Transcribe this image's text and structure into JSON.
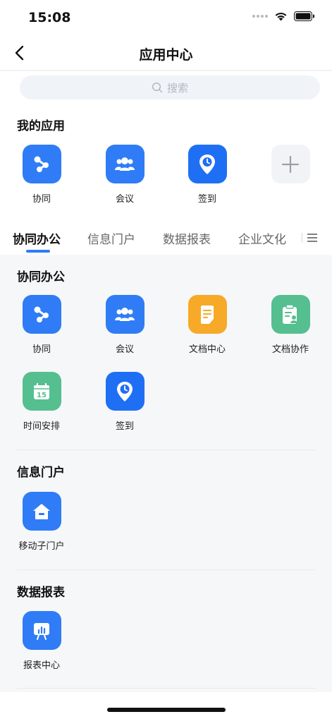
{
  "status": {
    "time": "15:08"
  },
  "nav": {
    "title": "应用中心"
  },
  "search": {
    "placeholder": "搜索"
  },
  "my_apps": {
    "title": "我的应用",
    "items": [
      {
        "label": "协同",
        "icon": "share-nodes-icon",
        "color": "#2f7cf6"
      },
      {
        "label": "会议",
        "icon": "people-group-icon",
        "color": "#2f7cf6"
      },
      {
        "label": "签到",
        "icon": "location-clock-icon",
        "color": "#1f6ff5"
      },
      {
        "label": "",
        "icon": "plus-icon",
        "color": "#f1f3f7"
      }
    ]
  },
  "tabs": [
    {
      "label": "协同办公",
      "active": true
    },
    {
      "label": "信息门户",
      "active": false
    },
    {
      "label": "数据报表",
      "active": false
    },
    {
      "label": "企业文化",
      "active": false
    }
  ],
  "categories": [
    {
      "title": "协同办公",
      "items": [
        {
          "label": "协同",
          "icon": "share-nodes-icon",
          "color": "#2f7cf6"
        },
        {
          "label": "会议",
          "icon": "people-group-icon",
          "color": "#2f7cf6"
        },
        {
          "label": "文档中心",
          "icon": "document-icon",
          "color": "#f7a928"
        },
        {
          "label": "文档协作",
          "icon": "clipboard-user-icon",
          "color": "#55bf8f"
        },
        {
          "label": "时间安排",
          "icon": "calendar-icon",
          "color": "#55bf8f"
        },
        {
          "label": "签到",
          "icon": "location-clock-icon",
          "color": "#1f6ff5"
        }
      ]
    },
    {
      "title": "信息门户",
      "items": [
        {
          "label": "移动子门户",
          "icon": "home-icon",
          "color": "#2f7cf6"
        }
      ]
    },
    {
      "title": "数据报表",
      "items": [
        {
          "label": "报表中心",
          "icon": "presentation-chart-icon",
          "color": "#2f7cf6"
        }
      ]
    }
  ],
  "colors": {
    "accent": "#2f7cf6",
    "orange": "#f7a928",
    "green": "#55bf8f"
  }
}
